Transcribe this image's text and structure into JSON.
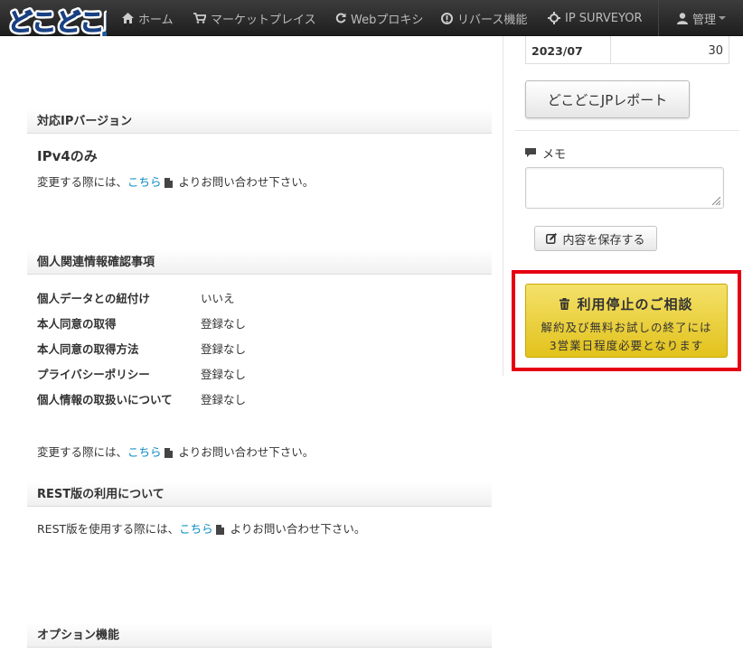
{
  "nav": {
    "logo_text": "どこどこJP",
    "items": [
      {
        "label": "ホーム",
        "icon": "home-icon"
      },
      {
        "label": "マーケットプレイス",
        "icon": "cart-icon"
      },
      {
        "label": "Webプロキシ",
        "icon": "refresh-icon"
      },
      {
        "label": "リバース機能",
        "icon": "circle-info-icon"
      },
      {
        "label": "IP SURVEYOR",
        "icon": "crosshair-icon"
      }
    ],
    "admin_label": "管理"
  },
  "ip_version": {
    "header": "対応IPバージョン",
    "value": "IPv4のみ",
    "note_prefix": "変更する際には、",
    "note_link": "こちら",
    "note_suffix": "よりお問い合わせ下さい。"
  },
  "personal_info": {
    "header": "個人関連情報確認事項",
    "rows": [
      {
        "label": "個人データとの紐付け",
        "value": "いいえ"
      },
      {
        "label": "本人同意の取得",
        "value": "登録なし"
      },
      {
        "label": "本人同意の取得方法",
        "value": "登録なし"
      },
      {
        "label": "プライバシーポリシー",
        "value": "登録なし"
      },
      {
        "label": "個人情報の取扱いについて",
        "value": "登録なし"
      }
    ],
    "note_prefix": "変更する際には、",
    "note_link": "こちら",
    "note_suffix": "よりお問い合わせ下さい。"
  },
  "rest": {
    "header": "REST版の利用について",
    "note_prefix": "REST版を使用する際には、",
    "note_link": "こちら",
    "note_suffix": "よりお問い合わせ下さい。"
  },
  "options": {
    "header": "オプション機能"
  },
  "sidebar": {
    "usage_row": {
      "month": "2023/07",
      "count": "30"
    },
    "report_button": "どこどこJPレポート",
    "memo_label": "メモ",
    "memo_value": "",
    "save_button": "内容を保存する",
    "cancel_button": {
      "title": "利用停止のご相談",
      "line1": "解約及び無料お試しの終了には",
      "line2": "3営業日程度必要となります"
    }
  },
  "colors": {
    "navbar": "#2b2b2b",
    "link": "#0a8bc2",
    "cancel_button": "#e8cb2a",
    "highlight_frame": "#e60012"
  }
}
